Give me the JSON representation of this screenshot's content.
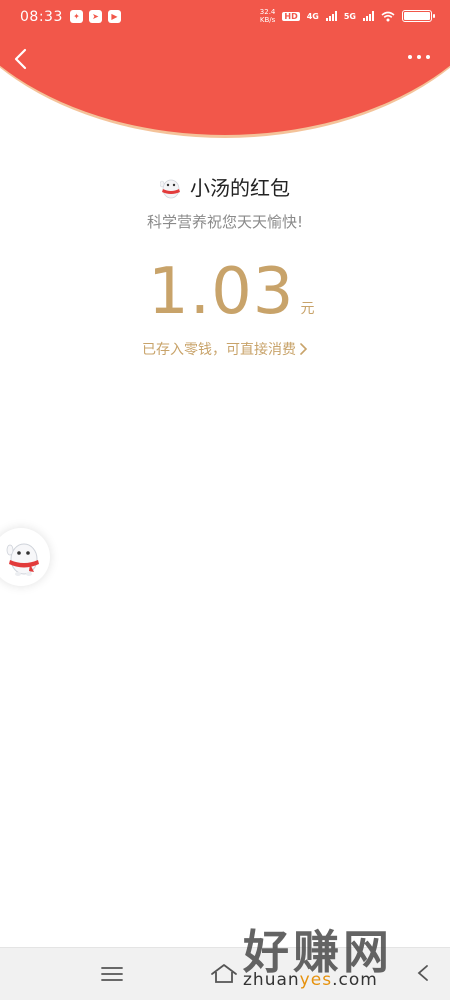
{
  "status_bar": {
    "time": "08:33",
    "speed_value": "32.4",
    "speed_unit": "KB/s",
    "hd_label": "HD",
    "net1": "4G",
    "net2": "5G"
  },
  "red_packet": {
    "sender_title": "小汤的红包",
    "greeting": "科学营养祝您天天愉快!",
    "amount": "1.03",
    "unit": "元",
    "deposit_tip": "已存入零钱，可直接消费"
  },
  "watermark": {
    "brand": "好赚网",
    "url_prefix": "zhuan",
    "url_highlight": "yes",
    "url_suffix": ".com"
  },
  "colors": {
    "header_red": "#f2574a",
    "gold": "#c8a36a",
    "watermark_orange": "#e6920e"
  },
  "icons": [
    "back-icon",
    "more-icon",
    "mascot-icon",
    "chevron-right-icon",
    "menu-icon",
    "home-icon",
    "back-nav-icon"
  ]
}
